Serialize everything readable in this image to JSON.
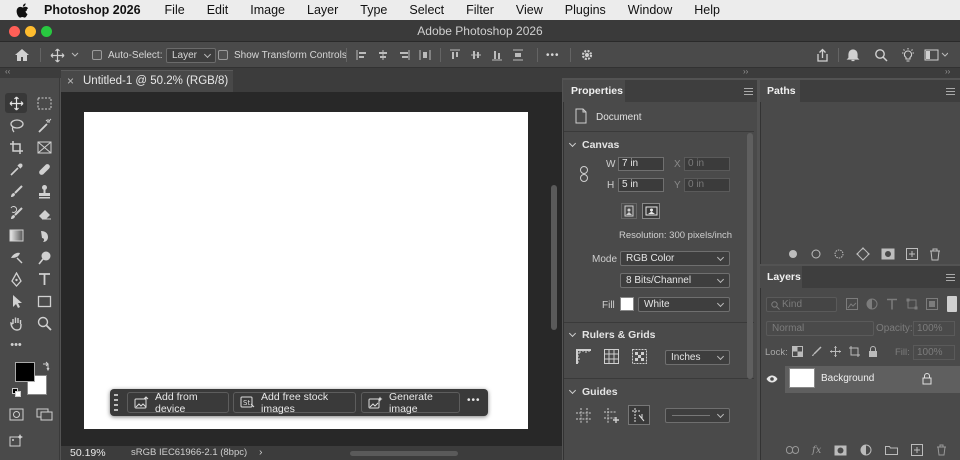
{
  "menubar": {
    "app_name": "Photoshop 2026",
    "items": [
      "File",
      "Edit",
      "Image",
      "Layer",
      "Type",
      "Select",
      "Filter",
      "View",
      "Plugins",
      "Window",
      "Help"
    ]
  },
  "window": {
    "title": "Adobe Photoshop 2026",
    "traffic_lights": {
      "close": "#ff5f57",
      "minimize": "#febc2e",
      "zoom": "#28c840"
    }
  },
  "options_bar": {
    "auto_select_label": "Auto-Select:",
    "auto_select_target": "Layer",
    "show_transform_label": "Show Transform Controls",
    "more_label": "•••"
  },
  "document": {
    "tab_title": "Untitled-1 @ 50.2% (RGB/8) *",
    "zoom": "50.19%",
    "color_profile": "sRGB IEC61966-2.1 (8bpc)",
    "status_arrow": "›"
  },
  "task_bar": {
    "buttons": [
      "Add from device",
      "Add free stock images",
      "Generate image"
    ],
    "more": "•••"
  },
  "properties": {
    "tab": "Properties",
    "document_label": "Document",
    "canvas": {
      "title": "Canvas",
      "w_label": "W",
      "w_value": "7 in",
      "h_label": "H",
      "h_value": "5 in",
      "x_label": "X",
      "x_value": "0 in",
      "y_label": "Y",
      "y_value": "0 in",
      "resolution": "Resolution: 300 pixels/inch",
      "mode_label": "Mode",
      "mode_value": "RGB Color",
      "bits_value": "8 Bits/Channel",
      "fill_label": "Fill",
      "fill_value": "White"
    },
    "rulers": {
      "title": "Rulers & Grids",
      "unit": "Inches"
    },
    "guides": {
      "title": "Guides"
    }
  },
  "paths": {
    "tab": "Paths"
  },
  "layers": {
    "tab": "Layers",
    "search_placeholder": "Kind",
    "blend_mode": "Normal",
    "opacity_label": "Opacity:",
    "opacity_value": "100%",
    "lock_label": "Lock:",
    "fill_label": "Fill:",
    "fill_value": "100%",
    "items": [
      {
        "name": "Background",
        "locked": true,
        "visible": true
      }
    ]
  },
  "colors": {
    "foreground": "#000000",
    "background": "#ffffff"
  }
}
